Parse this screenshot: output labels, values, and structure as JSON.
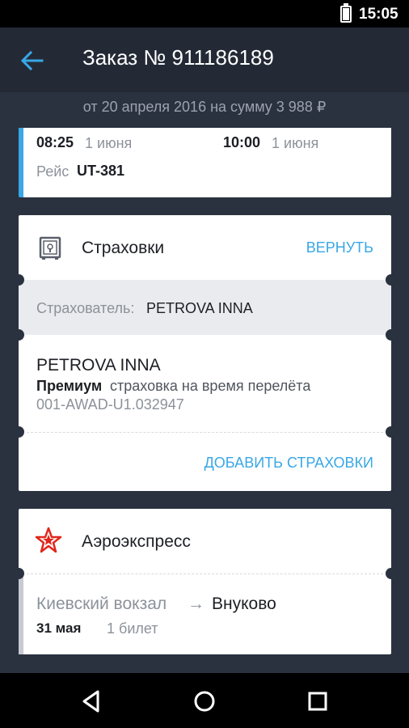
{
  "status": {
    "time": "15:05"
  },
  "header": {
    "title": "Заказ № 911186189"
  },
  "order_summary": "от 20 апреля 2016 на сумму 3 988 ₽",
  "flight": {
    "dep_time": "08:25",
    "dep_date": "1 июня",
    "arr_time": "10:00",
    "arr_date": "1 июня",
    "flight_label": "Рейс",
    "flight_number": "UT-381"
  },
  "insurance": {
    "title": "Страховки",
    "return_label": "ВЕРНУТЬ",
    "insurer_label": "Страхователь:",
    "insurer_name": "PETROVA INNA",
    "person": "PETROVA INNA",
    "plan": "Премиум",
    "plan_desc": "страховка на время перелёта",
    "policy_number": "001-AWAD-U1.032947",
    "add_label": "ДОБАВИТЬ СТРАХОВКИ"
  },
  "aeroexpress": {
    "title": "Аэроэкспресс",
    "from": "Киевский вокзал",
    "arrow": "→",
    "to": "Внуково",
    "date": "31 мая",
    "tickets": "1 билет"
  },
  "icons": {
    "back": "arrow-left-icon",
    "safe": "safe-icon",
    "aeroexpress": "aeroexpress-star-icon",
    "nav": [
      "back-triangle-icon",
      "home-circle-icon",
      "recents-square-icon"
    ]
  },
  "colors": {
    "accent": "#3aa7e6",
    "background": "#2b323f",
    "appbar": "#232a36",
    "logo_red": "#e0261b"
  }
}
